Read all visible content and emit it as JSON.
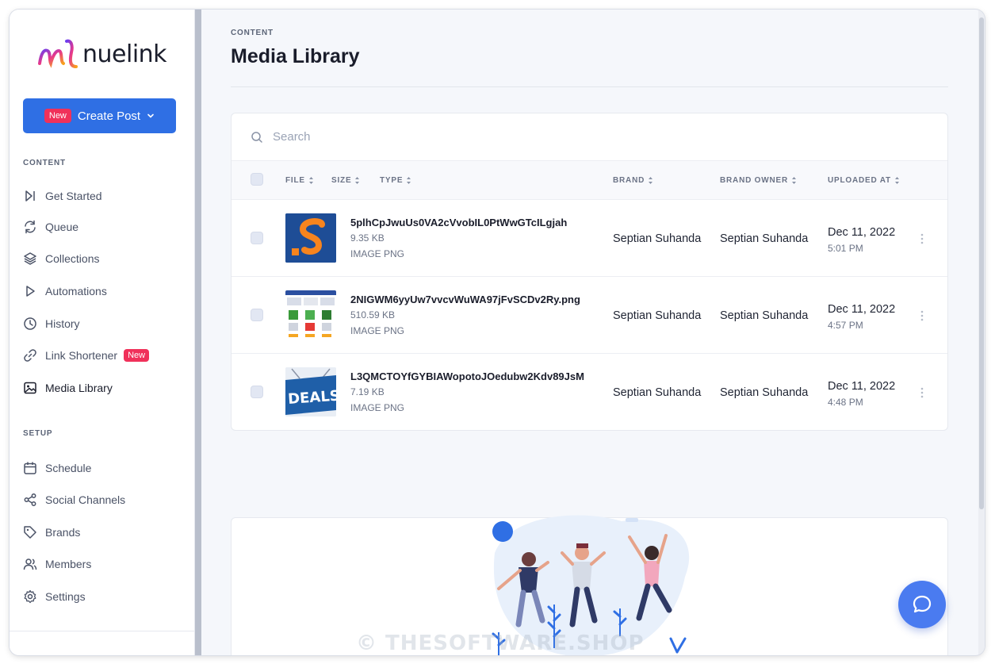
{
  "brand": {
    "name": "nuelink"
  },
  "sidebar": {
    "create_post": {
      "badge": "New",
      "label": "Create Post"
    },
    "content_label": "CONTENT",
    "content_items": [
      {
        "label": "Get Started",
        "icon": "get-started-icon"
      },
      {
        "label": "Queue",
        "icon": "refresh-icon"
      },
      {
        "label": "Collections",
        "icon": "layers-icon"
      },
      {
        "label": "Automations",
        "icon": "play-icon"
      },
      {
        "label": "History",
        "icon": "clock-icon"
      },
      {
        "label": "Link Shortener",
        "icon": "link-icon",
        "badge": "New"
      },
      {
        "label": "Media Library",
        "icon": "image-icon",
        "active": true
      }
    ],
    "setup_label": "SETUP",
    "setup_items": [
      {
        "label": "Schedule",
        "icon": "calendar-icon"
      },
      {
        "label": "Social Channels",
        "icon": "share-icon"
      },
      {
        "label": "Brands",
        "icon": "tag-icon"
      },
      {
        "label": "Members",
        "icon": "users-icon"
      },
      {
        "label": "Settings",
        "icon": "gear-icon"
      }
    ]
  },
  "header": {
    "breadcrumb": "CONTENT",
    "title": "Media Library"
  },
  "search": {
    "placeholder": "Search"
  },
  "table": {
    "columns": [
      "FILE",
      "SIZE",
      "TYPE",
      "BRAND",
      "BRAND OWNER",
      "UPLOADED AT"
    ],
    "rows": [
      {
        "file": "5plhCpJwuUs0VA2cVvobIL0PtWwGTcILgjah",
        "size": "9.35 KB",
        "type": "IMAGE PNG",
        "brand": "Septian Suhanda",
        "owner": "Septian Suhanda",
        "date": "Dec 11, 2022",
        "time": "5:01 PM"
      },
      {
        "file": "2NIGWM6yyUw7vvcvWuWA97jFvSCDv2Ry.png",
        "size": "510.59 KB",
        "type": "IMAGE PNG",
        "brand": "Septian Suhanda",
        "owner": "Septian Suhanda",
        "date": "Dec 11, 2022",
        "time": "4:57 PM"
      },
      {
        "file": "L3QMCTOYfGYBIAWopotoJOedubw2Kdv89JsM",
        "size": "7.19 KB",
        "type": "IMAGE PNG",
        "brand": "Septian Suhanda",
        "owner": "Septian Suhanda",
        "date": "Dec 11, 2022",
        "time": "4:48 PM"
      }
    ],
    "thumb_deals_text": "DEALS"
  },
  "watermark": "© THESOFTWARE.SHOP",
  "colors": {
    "primary": "#2f6fe4",
    "badge": "#f0315a",
    "chat": "#4a7bf0"
  }
}
